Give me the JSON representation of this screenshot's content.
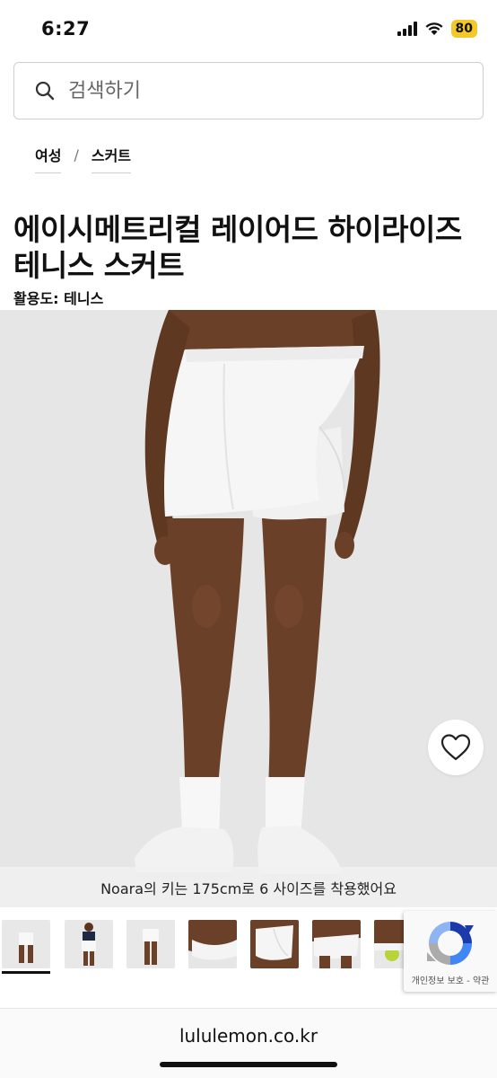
{
  "status_bar": {
    "time": "6:27",
    "battery": "80",
    "icons": [
      "signal-icon",
      "wifi-icon",
      "battery-icon"
    ],
    "battery_color": "#f2c927"
  },
  "search": {
    "placeholder": "검색하기",
    "icon": "search-icon"
  },
  "breadcrumb": {
    "items": [
      "여성",
      "스커트"
    ],
    "separator": "/"
  },
  "product": {
    "title": "에이시메트리컬 레이어드 하이라이즈 테니스 스커트",
    "activity": "활용도: 테니스",
    "model_caption": "Noara의 키는 175cm로 6 사이즈를 착용했어요",
    "wishlist_icon": "heart-icon"
  },
  "gallery": {
    "thumbnail_count": 8,
    "selected_index": 0
  },
  "recaptcha": {
    "links": "개인정보 보호 - 약관"
  },
  "browser": {
    "url": "lululemon.co.kr"
  },
  "colors": {
    "hero_background": "#e6e6e6",
    "skirt": "#f6f6f6",
    "skin": "#6b4028",
    "text": "#111111"
  }
}
